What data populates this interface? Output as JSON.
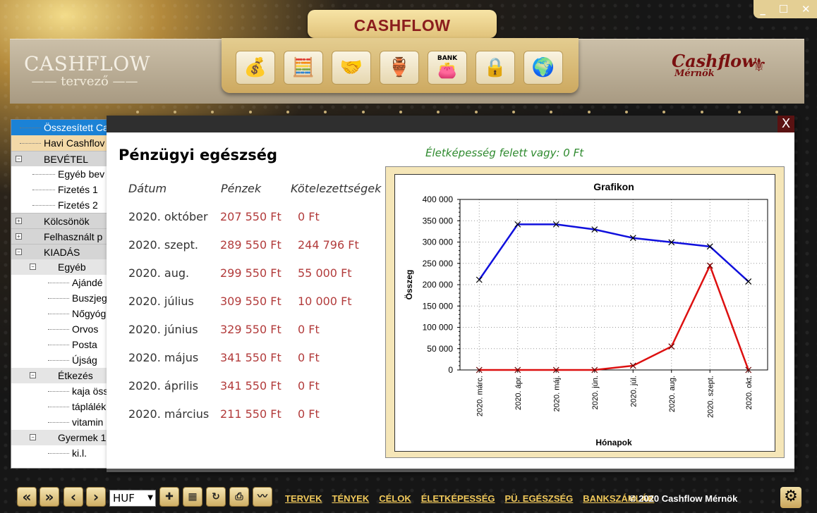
{
  "app": {
    "title": "CASHFLOW",
    "logo_line1": "CASHFLOW",
    "logo_line2": "—— tervező ——",
    "brand_line1": "Cashflow",
    "brand_line2": "Mérnök"
  },
  "window_controls": [
    "_",
    "☐",
    "✕"
  ],
  "toolbar": {
    "icons": [
      "money-bag-icon",
      "calculator-money-icon",
      "handshake-money-icon",
      "savings-jar-icon",
      "bank-icon",
      "safe-icon",
      "globe-money-icon"
    ],
    "bank_label": "BANK"
  },
  "tree": [
    {
      "label": "Összesített Ca",
      "level": 0,
      "style": "sel"
    },
    {
      "label": "Havi Cashflov",
      "level": 0,
      "style": "hav"
    },
    {
      "label": "BEVÉTEL",
      "level": 0,
      "style": "cat",
      "toggle": "−"
    },
    {
      "label": "Egyéb bev",
      "level": 1,
      "style": ""
    },
    {
      "label": "Fizetés 1",
      "level": 1,
      "style": ""
    },
    {
      "label": "Fizetés 2",
      "level": 1,
      "style": ""
    },
    {
      "label": "Kölcsönök",
      "level": 0,
      "style": "cat",
      "toggle": "+"
    },
    {
      "label": "Felhasznált p",
      "level": 0,
      "style": "cat",
      "toggle": "+"
    },
    {
      "label": "KIADÁS",
      "level": 0,
      "style": "cat",
      "toggle": "−"
    },
    {
      "label": "Egyéb",
      "level": 1,
      "style": "sub",
      "toggle": "−"
    },
    {
      "label": "Ajándé",
      "level": 2,
      "style": ""
    },
    {
      "label": "Buszjeg",
      "level": 2,
      "style": ""
    },
    {
      "label": "Nőgyóg",
      "level": 2,
      "style": ""
    },
    {
      "label": "Orvos",
      "level": 2,
      "style": ""
    },
    {
      "label": "Posta",
      "level": 2,
      "style": ""
    },
    {
      "label": "Újság",
      "level": 2,
      "style": ""
    },
    {
      "label": "Étkezés",
      "level": 1,
      "style": "sub",
      "toggle": "−"
    },
    {
      "label": "kaja öss",
      "level": 2,
      "style": ""
    },
    {
      "label": "táplálék",
      "level": 2,
      "style": ""
    },
    {
      "label": "vitamin",
      "level": 2,
      "style": ""
    },
    {
      "label": "Gyermek 1",
      "level": 1,
      "style": "sub",
      "toggle": "−"
    },
    {
      "label": "ki.l.",
      "level": 2,
      "style": ""
    }
  ],
  "dialog": {
    "close": "X",
    "title": "Pénzügyi egészség",
    "status": "Életképesség felett vagy: 0 Ft",
    "headers": [
      "Dátum",
      "Pénzek",
      "Kötelezettségek"
    ],
    "rows": [
      [
        "2020. október",
        "207 550 Ft",
        "0 Ft"
      ],
      [
        "2020. szept.",
        "289 550 Ft",
        "244 796 Ft"
      ],
      [
        "2020. aug.",
        "299 550 Ft",
        "55 000 Ft"
      ],
      [
        "2020. július",
        "309 550 Ft",
        "10 000 Ft"
      ],
      [
        "2020. június",
        "329 550 Ft",
        "0 Ft"
      ],
      [
        "2020. május",
        "341 550 Ft",
        "0 Ft"
      ],
      [
        "2020. április",
        "341 550 Ft",
        "0 Ft"
      ],
      [
        "2020. március",
        "211 550 Ft",
        "0 Ft"
      ]
    ]
  },
  "chart_data": {
    "type": "line",
    "title": "Grafikon",
    "xlabel": "Hónapok",
    "ylabel": "Összeg",
    "categories": [
      "2020. márc.",
      "2020. ápr.",
      "2020. máj.",
      "2020. jún.",
      "2020. júl.",
      "2020. aug.",
      "2020. szept.",
      "2020. okt."
    ],
    "ylim": [
      0,
      400000
    ],
    "yticks": [
      "0",
      "50 000",
      "100 000",
      "150 000",
      "200 000",
      "250 000",
      "300 000",
      "350 000",
      "400 000"
    ],
    "series": [
      {
        "color": "#1010dd",
        "values": [
          211550,
          341550,
          341550,
          329550,
          309550,
          299550,
          289550,
          207550
        ]
      },
      {
        "color": "#dd1010",
        "values": [
          0,
          0,
          0,
          0,
          10000,
          55000,
          244796,
          0
        ]
      }
    ],
    "grid": "dotted"
  },
  "bottom": {
    "currency": "HUF",
    "links": [
      "TERVEK",
      "TÉNYEK",
      "CÉLOK",
      "ÉLETKÉPESSÉG",
      "PÜ. EGÉSZSÉG",
      "BANKSZÁMLÁK"
    ],
    "copyright": "© 2020 Cashflow Mérnök"
  }
}
